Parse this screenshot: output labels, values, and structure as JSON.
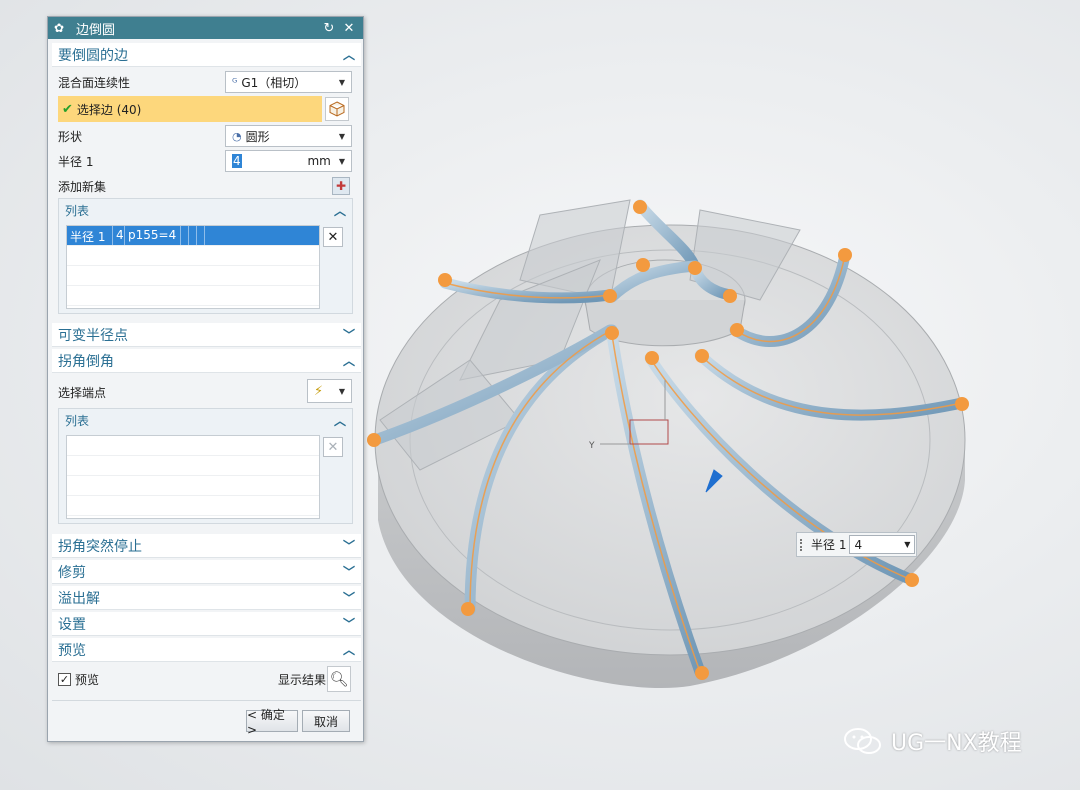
{
  "dialog": {
    "title": "边倒圆",
    "reset_icon": "reset-icon",
    "close_icon": "close-icon",
    "edges_section": {
      "title": "要倒圆的边",
      "continuity_label": "混合面连续性",
      "continuity_value": "G1（相切）",
      "select_edge_label": "选择边 (40)",
      "shape_label": "形状",
      "shape_value": "圆形",
      "radius_label": "半径 1",
      "radius_value": "4",
      "radius_unit": "mm",
      "add_new_set_label": "添加新集",
      "list_title": "列表",
      "list_rows": [
        {
          "cells": [
            "半径 1",
            "4",
            "p155=4",
            "",
            "",
            ""
          ]
        }
      ]
    },
    "variable_radius_title": "可变半径点",
    "corner_section": {
      "title": "拐角倒角",
      "select_endpoint_label": "选择端点",
      "list_title": "列表"
    },
    "corner_stop_title": "拐角突然停止",
    "trim_title": "修剪",
    "overflow_title": "溢出解",
    "settings_title": "设置",
    "preview_section": {
      "title": "预览",
      "preview_label": "预览",
      "preview_checked": true,
      "show_result_label": "显示结果"
    },
    "ok_label": "< 确定 >",
    "cancel_label": "取消"
  },
  "radius_box": {
    "label": "半径 1",
    "value": "4"
  },
  "axis_label": "Y",
  "watermark": "UG一NX教程",
  "colors": {
    "title_bar": "#3f7f90",
    "section_text": "#2a6f93",
    "selection_highlight": "#fdd77c",
    "list_selected": "#2f85d6",
    "edge_marker": "#f39a3f",
    "blade_fillet": "#7fa6c2"
  }
}
